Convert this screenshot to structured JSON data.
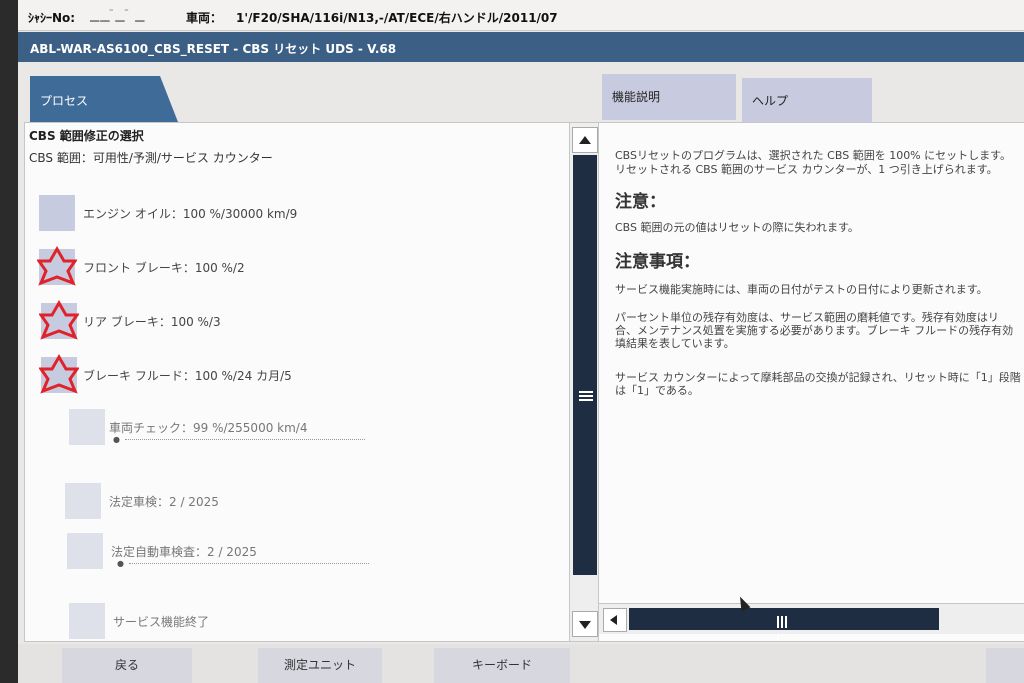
{
  "header": {
    "chassis_label": "ｼｬｼｰNo:",
    "chassis_value": "▁▁ ̄▁ ̄ ▁",
    "vehicle_label": "車両：",
    "vehicle_value": "1'/F20/SHA/116i/N13,-/AT/ECE/右ハンドル/2011/07"
  },
  "title": "ABL-WAR-AS6100_CBS_RESET - CBS リセット UDS - V.68",
  "tabs": {
    "process": "プロセス",
    "function_description": "機能説明",
    "help": "ヘルプ"
  },
  "left_panel": {
    "header": "CBS 範囲修正の選択",
    "subheader": "CBS 範囲：可用性/予測/サービス カウンター",
    "items": [
      {
        "label": "エンジン オイル：100 %/30000 km/9",
        "marker": "square",
        "faded": false
      },
      {
        "label": "フロント ブレーキ：100 %/2",
        "marker": "star",
        "faded": false
      },
      {
        "label": "リア ブレーキ：100 %/3",
        "marker": "star",
        "faded": false
      },
      {
        "label": "ブレーキ フルード：100 %/24 カ月/5",
        "marker": "star",
        "faded": false
      },
      {
        "label": "車両チェック：99 %/255000 km/4",
        "marker": "square",
        "faded": true
      },
      {
        "label": "法定車検：2 / 2025",
        "marker": "square",
        "faded": true
      },
      {
        "label": "法定自動車検査：2 / 2025",
        "marker": "square",
        "faded": true
      },
      {
        "label": "サービス機能終了",
        "marker": "square",
        "faded": true
      }
    ]
  },
  "right_panel": {
    "intro_line1": "CBSリセットのプログラムは、選択された CBS 範囲を 100% にセットします。",
    "intro_line2": "リセットされる CBS 範囲のサービス カウンターが、1 つ引き上げられます。",
    "notice_title": "注意：",
    "notice_text": "CBS 範囲の元の値はリセットの際に失われます。",
    "notes_title": "注意事項：",
    "note1": "サービス機能実施時には、車両の日付がテストの日付により更新されます。",
    "note2_line1": "パーセント単位の残存有効度は、サービス範囲の磨耗値です。残存有効度はリ",
    "note2_line2": "合、メンテナンス処置を実施する必要があります。ブレーキ フルードの残存有効",
    "note2_line3": "填結果を表しています。",
    "note3_line1": "サービス カウンターによって摩耗部品の交換が記録され、リセット時に「1」段階",
    "note3_line2": "は「1」である。"
  },
  "bottom": {
    "back": "戻る",
    "measure": "測定ユニット",
    "keyboard": "キーボード"
  },
  "colors": {
    "title_bar": "#3c5f86",
    "tab_active": "#3f6b98",
    "tab_inactive": "#c8cbe0",
    "scroll_thumb": "#1f2d42",
    "star_marker": "#e0222a"
  }
}
